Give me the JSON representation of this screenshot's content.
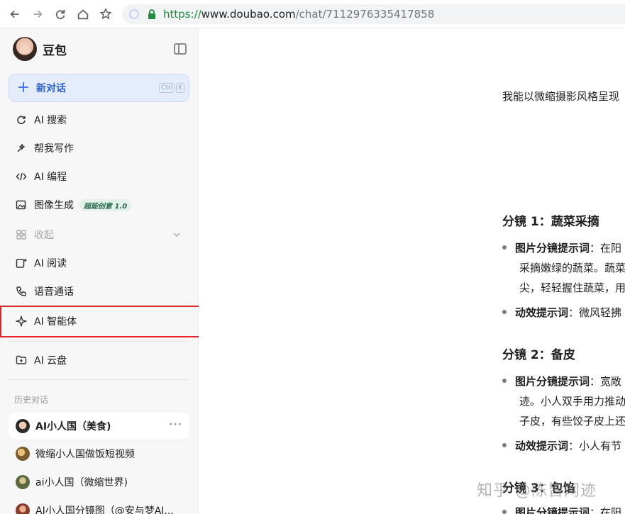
{
  "browser": {
    "url_scheme": "https://",
    "url_host": "www.doubao.com",
    "url_path": "/chat/7112976335417858"
  },
  "sidebar": {
    "brand": "豆包",
    "new_chat": {
      "label": "新对话",
      "shortcut": [
        "Ctrl",
        "K"
      ]
    },
    "items": [
      {
        "label": "AI 搜索"
      },
      {
        "label": "帮我写作"
      },
      {
        "label": "AI 编程"
      },
      {
        "label": "图像生成",
        "badge": "超能创意 1.0"
      },
      {
        "label": "收起"
      },
      {
        "label": "AI 阅读"
      },
      {
        "label": "语音通话"
      },
      {
        "label": "AI 智能体"
      },
      {
        "label": "AI 云盘"
      }
    ],
    "history_label": "历史对话",
    "history": [
      {
        "label": "AI小人国（美食)"
      },
      {
        "label": "微缩小人国做饭短视频"
      },
      {
        "label": "ai小人国（微缩世界)"
      },
      {
        "label": "AI小人国分镜图（@安与梦AI..."
      }
    ]
  },
  "main": {
    "intro": "我能以微缩摄影风格呈现",
    "scene1": {
      "title": "分镜 1：蔬菜采摘",
      "b1_key": "图片分镜提示词",
      "b1_text": "：在阳",
      "b1_l2": "采摘嫩绿的蔬菜。蔬菜",
      "b1_l3": "尖，轻轻握住蔬菜，用",
      "b2_key": "动效提示词",
      "b2_text": "：微风轻拂"
    },
    "scene2": {
      "title": "分镜 2：备皮",
      "b1_key": "图片分镜提示词",
      "b1_text": "：宽敞",
      "b1_l2": "迹。小人双手用力推动",
      "b1_l3": "子皮，有些饺子皮上还",
      "b2_key": "动效提示词",
      "b2_text": "：小人有节"
    },
    "scene3": {
      "title": "分镜 3：包馅",
      "b1_key": "图片分镜提示词",
      "b1_text": "：在阳"
    }
  },
  "watermark": "知乎 @陈皆网迹"
}
